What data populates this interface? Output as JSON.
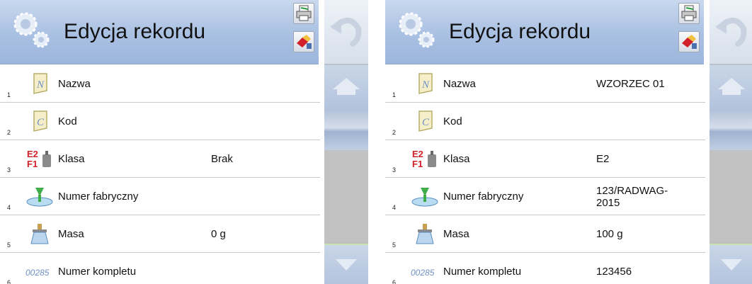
{
  "panels": [
    {
      "title": "Edycja rekordu",
      "rows": [
        {
          "num": "1",
          "label": "Nazwa",
          "value": "",
          "icon": "name-n-icon"
        },
        {
          "num": "2",
          "label": "Kod",
          "value": "",
          "icon": "code-c-icon"
        },
        {
          "num": "3",
          "label": "Klasa",
          "value": "Brak",
          "icon": "weight-class-icon"
        },
        {
          "num": "4",
          "label": "Numer fabryczny",
          "value": "",
          "icon": "factory-number-icon"
        },
        {
          "num": "5",
          "label": "Masa",
          "value": "0 g",
          "icon": "scale-mass-icon"
        },
        {
          "num": "6",
          "label": "Numer kompletu",
          "value": "",
          "icon": "set-number-icon"
        }
      ]
    },
    {
      "title": "Edycja rekordu",
      "rows": [
        {
          "num": "1",
          "label": "Nazwa",
          "value": "WZORZEC 01",
          "icon": "name-n-icon"
        },
        {
          "num": "2",
          "label": "Kod",
          "value": "",
          "icon": "code-c-icon"
        },
        {
          "num": "3",
          "label": "Klasa",
          "value": "E2",
          "icon": "weight-class-icon"
        },
        {
          "num": "4",
          "label": "Numer fabryczny",
          "value": "123/RADWAG-2015",
          "icon": "factory-number-icon"
        },
        {
          "num": "5",
          "label": "Masa",
          "value": "100 g",
          "icon": "scale-mass-icon"
        },
        {
          "num": "6",
          "label": "Numer kompletu",
          "value": "123456",
          "icon": "set-number-icon"
        }
      ]
    }
  ],
  "icon_text": {
    "class_top": "E2",
    "class_bottom": "F1",
    "set_number": "00285"
  },
  "colors": {
    "header_blue": "#a9c0e2",
    "sidebar_gray": "#bfbfbf",
    "class_red": "#d0202a",
    "icon_blue": "#6f8fc4"
  }
}
